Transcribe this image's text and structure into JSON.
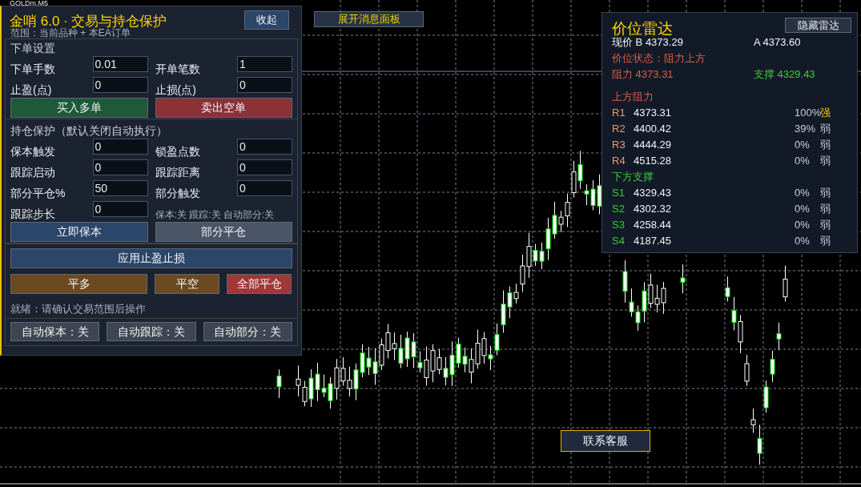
{
  "chart": {
    "symbol": "GOLDm,M5"
  },
  "message_button": "展开消息面板",
  "contact_button": "联系客服",
  "trade_panel": {
    "title": "金哨 6.0 · 交易与持仓保护",
    "collapse_button": "收起",
    "scope": "范围：当前品种 + 本EA订单",
    "order_section": {
      "heading": "下单设置",
      "fields": [
        {
          "label": "下单手数",
          "value": "0.01"
        },
        {
          "label": "开单笔数",
          "value": "1"
        },
        {
          "label": "止盈(点)",
          "value": "0"
        },
        {
          "label": "止损(点)",
          "value": "0"
        }
      ],
      "buttons": [
        {
          "label": "买入多单",
          "kind": "buy"
        },
        {
          "label": "卖出空单",
          "kind": "sell"
        }
      ]
    },
    "protection_section": {
      "heading": "持仓保护（默认关闭自动执行）",
      "fields": [
        {
          "label": "保本触发",
          "value": "0"
        },
        {
          "label": "锁盈点数",
          "value": "0"
        },
        {
          "label": "跟踪启动",
          "value": "0"
        },
        {
          "label": "跟踪距离",
          "value": "0"
        },
        {
          "label": "部分平仓%",
          "value": "50"
        },
        {
          "label": "部分触发",
          "value": "0"
        },
        {
          "label": "跟踪步长",
          "value": "0"
        }
      ],
      "status": "保本:关 跟踪:关 自动部分:关",
      "buttons": [
        {
          "label": "立即保本",
          "kind": "primary"
        },
        {
          "label": "部分平仓",
          "kind": "secondary"
        }
      ]
    },
    "actions": {
      "apply_button": "应用止盈止损",
      "close_buttons": [
        {
          "label": "平多",
          "kind": "close"
        },
        {
          "label": "平空",
          "kind": "close"
        },
        {
          "label": "全部平仓",
          "kind": "danger"
        }
      ],
      "status": "就绪：请确认交易范围后操作"
    },
    "auto_toggles": [
      {
        "label": "自动保本：关",
        "on": false
      },
      {
        "label": "自动跟踪：关",
        "on": false
      },
      {
        "label": "自动部分：关",
        "on": false
      }
    ]
  },
  "radar": {
    "title": "价位雷达",
    "hide_button": "隐藏雷达",
    "bid": "现价 B 4373.29",
    "ask": "A 4373.60",
    "state": "价位状态：阻力上方",
    "resistance": "阻力 4373.31",
    "support": "支撑 4329.43",
    "resistance_heading": "上方阻力",
    "resistance_levels": [
      {
        "name": "R1",
        "price": "4373.31",
        "percent": "100%",
        "strength": "强",
        "strong": true
      },
      {
        "name": "R2",
        "price": "4400.42",
        "percent": "39%",
        "strength": "弱",
        "strong": false
      },
      {
        "name": "R3",
        "price": "4444.29",
        "percent": "0%",
        "strength": "弱",
        "strong": false
      },
      {
        "name": "R4",
        "price": "4515.28",
        "percent": "0%",
        "strength": "弱",
        "strong": false
      }
    ],
    "support_heading": "下方支撑",
    "support_levels": [
      {
        "name": "S1",
        "price": "4329.43",
        "percent": "0%",
        "strength": "弱",
        "strong": false
      },
      {
        "name": "S2",
        "price": "4302.32",
        "percent": "0%",
        "strength": "弱",
        "strong": false
      },
      {
        "name": "S3",
        "price": "4258.44",
        "percent": "0%",
        "strength": "弱",
        "strong": false
      },
      {
        "name": "S4",
        "price": "4187.45",
        "percent": "0%",
        "strength": "弱",
        "strong": false
      }
    ]
  }
}
